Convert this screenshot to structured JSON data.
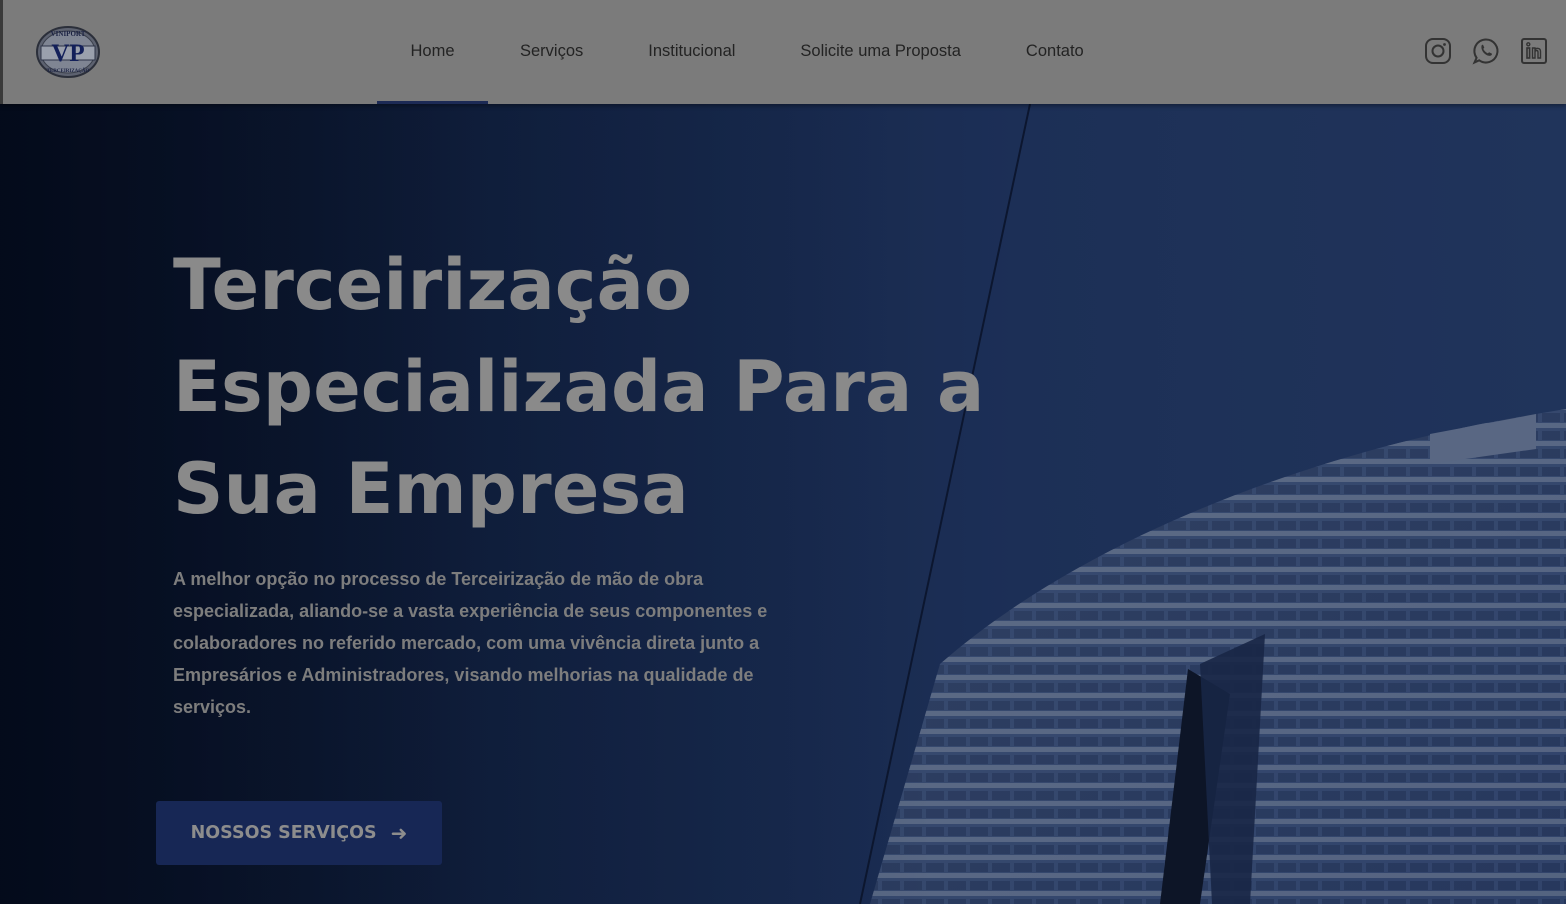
{
  "logo": {
    "letters": "VP",
    "top_text": "VINIPORT",
    "bottom_text": "TERCEIRIZAÇÃO"
  },
  "nav": {
    "items": [
      {
        "label": "Home",
        "active": true
      },
      {
        "label": "Serviços",
        "active": false
      },
      {
        "label": "Institucional",
        "active": false
      },
      {
        "label": "Solicite uma Proposta",
        "active": false
      },
      {
        "label": "Contato",
        "active": false
      }
    ]
  },
  "social": {
    "icons": [
      "instagram-icon",
      "whatsapp-icon",
      "linkedin-icon"
    ]
  },
  "hero": {
    "title_line1": "Terceirização",
    "title_line2": "Especializada Para a",
    "title_line3": "Sua Empresa",
    "description_line1": "A melhor opção no processo de Terceirização de mão de obra",
    "description_line2": "especializada, aliando-se a vasta experiência de seus componentes e",
    "description_line3": "colaboradores no referido mercado, com uma vivência direta junto a",
    "description_line4": "Empresários e Administradores, visando melhorias na qualidade de",
    "description_line5": "serviços.",
    "cta_label": "NOSSOS SERVIÇOS",
    "cta_arrow": "➜"
  },
  "colors": {
    "header_bg": "#7b7b7b",
    "nav_text": "#232323",
    "active_underline": "#1c2a55",
    "hero_bg": "#213666",
    "cta_bg": "#172755",
    "title_text": "#8a8a8a"
  }
}
